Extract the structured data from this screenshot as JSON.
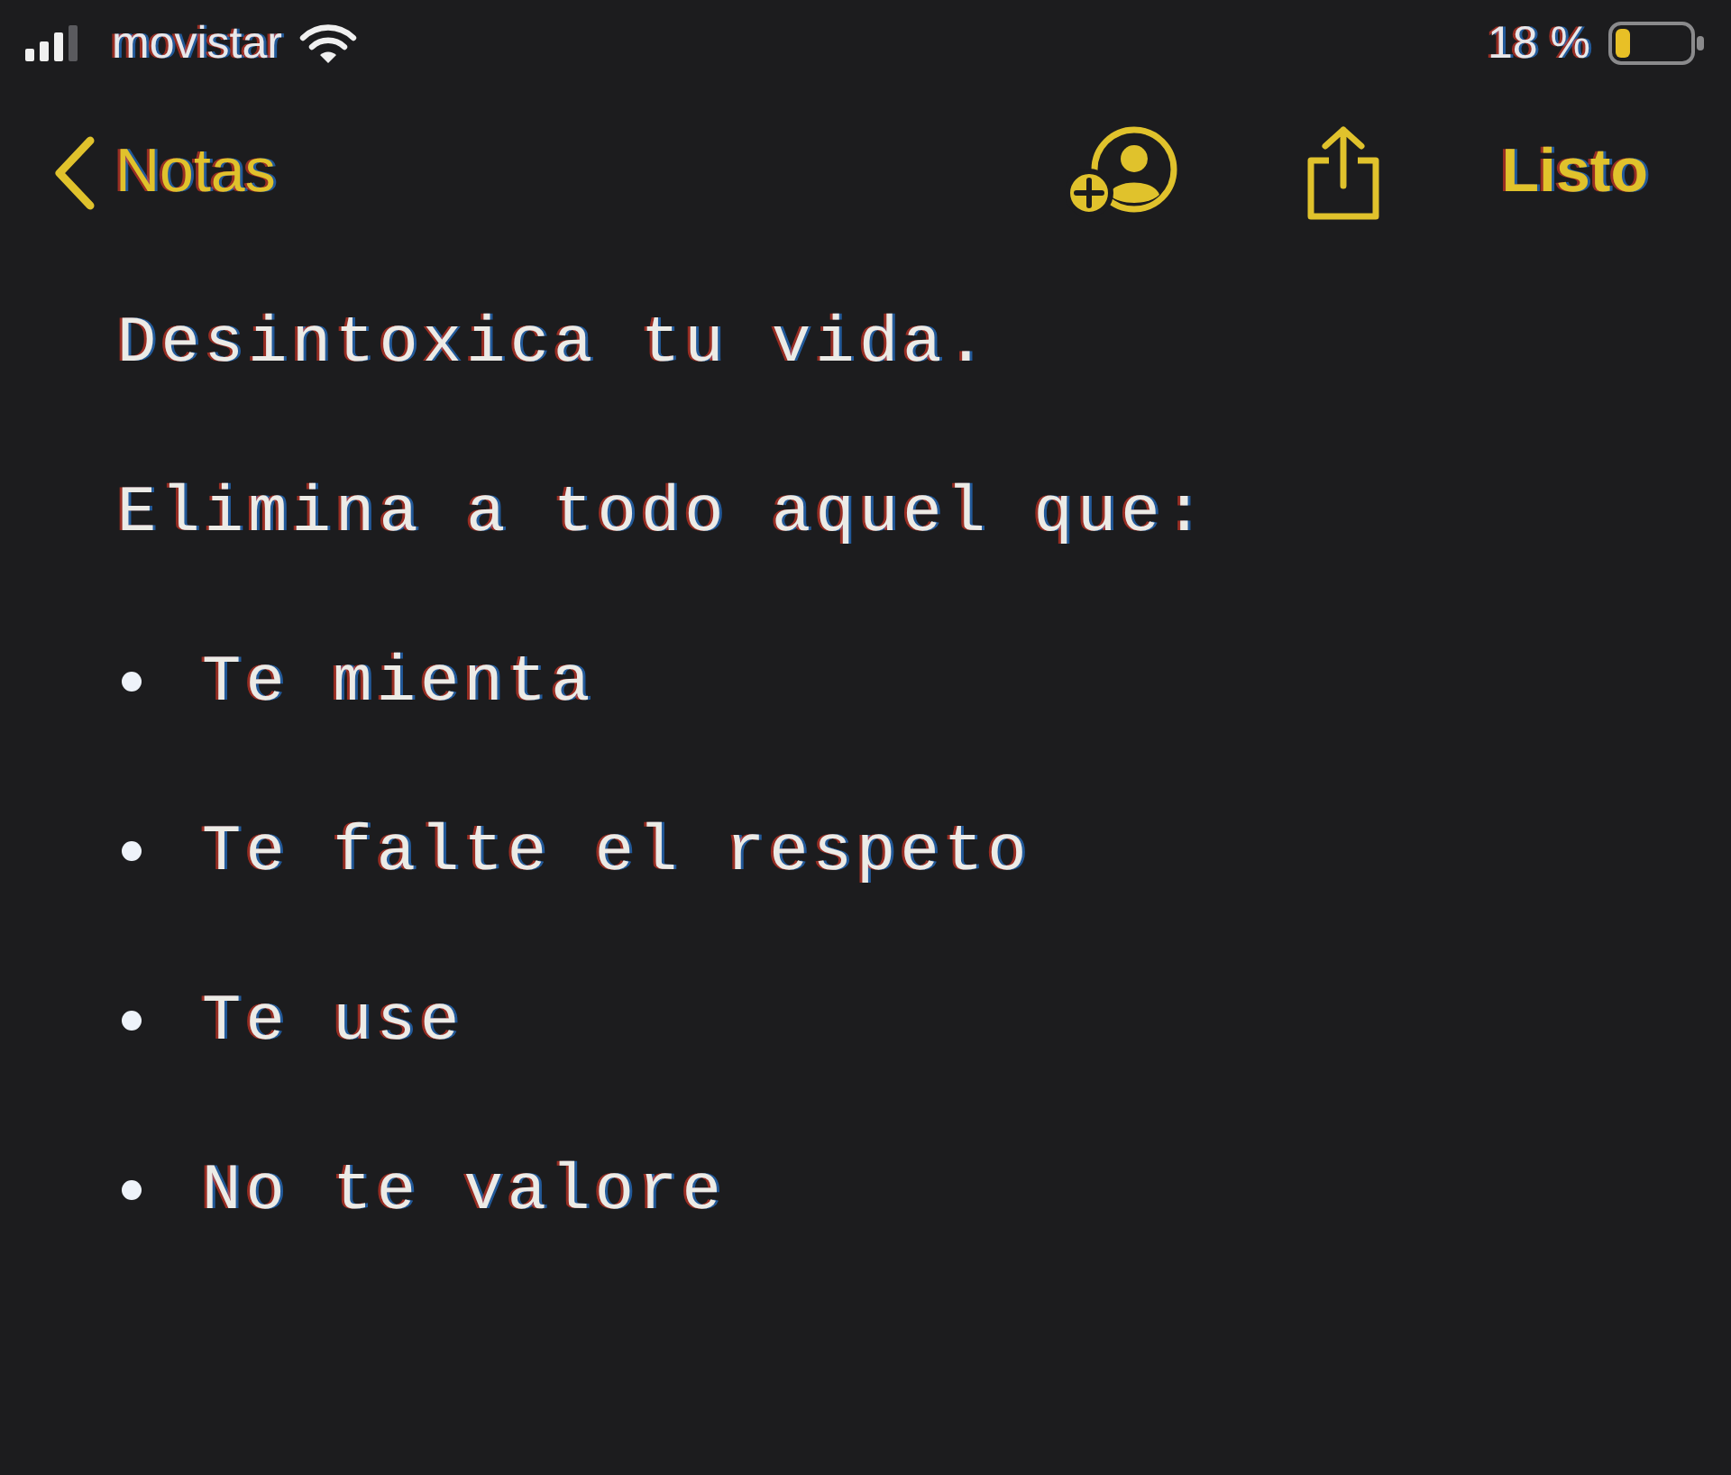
{
  "status_bar": {
    "carrier": "movistar",
    "battery_percent": "18 %"
  },
  "nav_bar": {
    "back_label": "Notas",
    "done_label": "Listo"
  },
  "note": {
    "lines": [
      {
        "kind": "paragraph",
        "text": "Desintoxica tu vida."
      },
      {
        "kind": "paragraph",
        "text": "Elimina a todo aquel que:"
      },
      {
        "kind": "bullet",
        "text": "Te mienta"
      },
      {
        "kind": "bullet",
        "text": "Te falte el respeto"
      },
      {
        "kind": "bullet",
        "text": "Te use"
      },
      {
        "kind": "bullet",
        "text": "No te valore"
      }
    ]
  }
}
